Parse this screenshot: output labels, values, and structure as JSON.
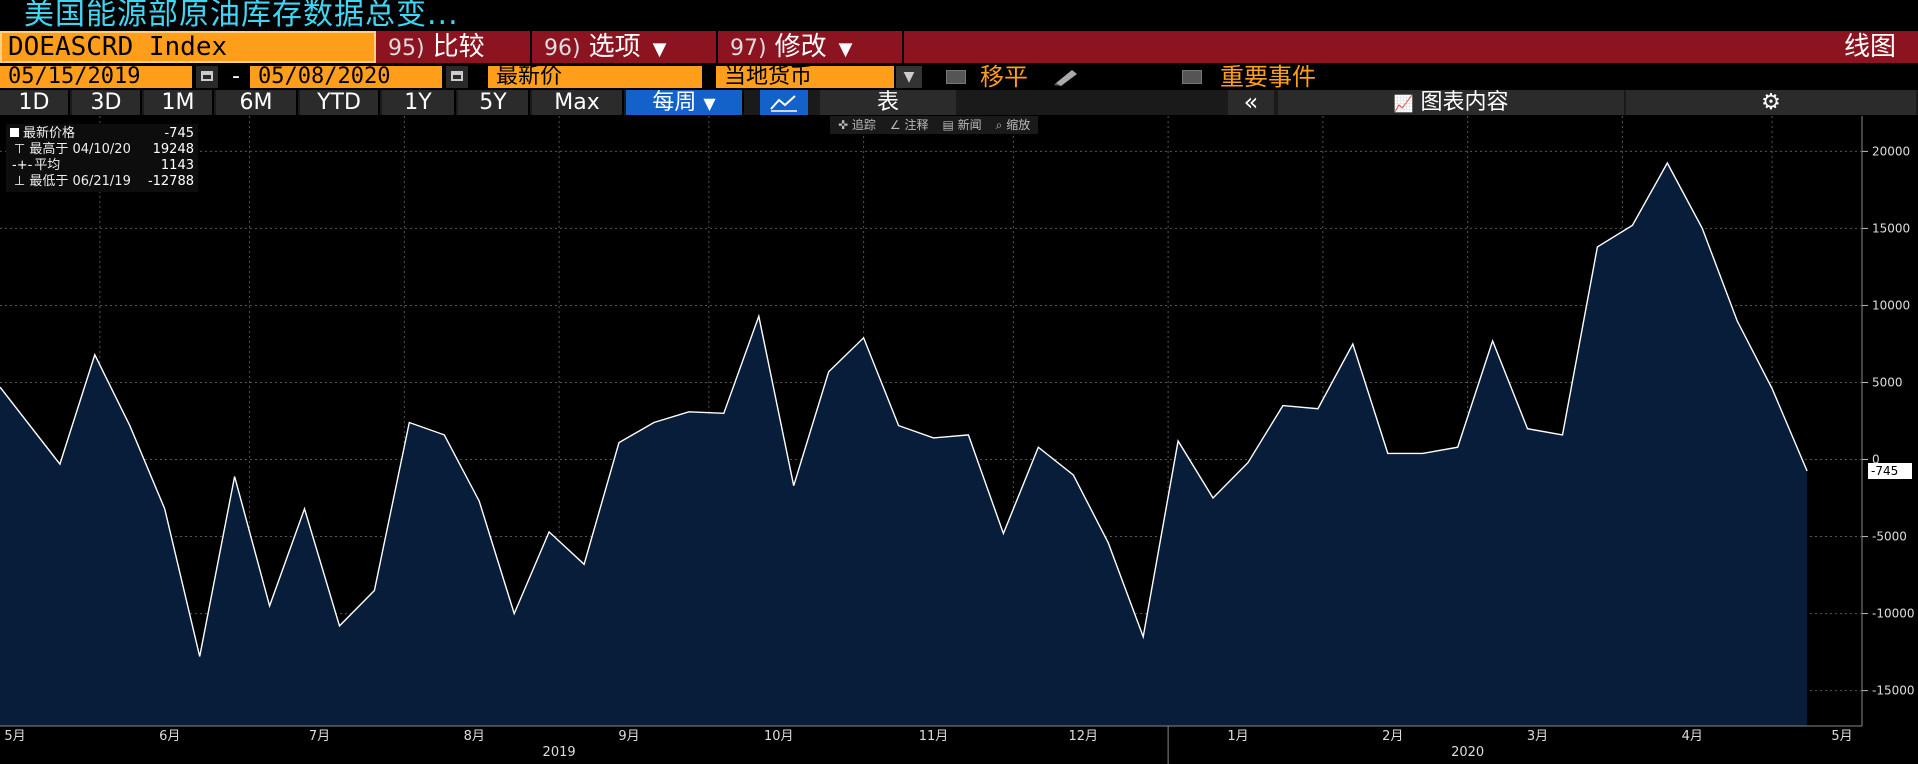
{
  "title": "美国能源部原油库存数据总变...",
  "ticker": "DOEASCRD Index",
  "menus": [
    {
      "num": "95)",
      "label": "比较",
      "arrow": ""
    },
    {
      "num": "96)",
      "label": "选项",
      "arrow": "▼"
    },
    {
      "num": "97)",
      "label": "修改",
      "arrow": "▼"
    }
  ],
  "chart_type_label": "线图",
  "date_start": "05/15/2019",
  "date_sep": "-",
  "date_end": "05/08/2020",
  "price_field": "最新价",
  "currency": "当地货币",
  "moving_avg_label": "移平",
  "events_label": "重要事件",
  "periods": [
    "1D",
    "3D",
    "1M",
    "6M",
    "YTD",
    "1Y",
    "5Y",
    "Max"
  ],
  "frequency": "每周",
  "table_label": "表",
  "chart_content_label": "图表内容",
  "mini_tools": [
    "追踪",
    "注释",
    "新闻",
    "缩放"
  ],
  "legend": [
    {
      "label": "最新价格",
      "value": "-745"
    },
    {
      "label": "最高于 04/10/20",
      "value": "19248"
    },
    {
      "label": "平均",
      "value": "1143"
    },
    {
      "label": "最低于 06/21/19",
      "value": "-12788"
    }
  ],
  "last_value_tag": "-745",
  "colors": {
    "line": "#ffffff",
    "fill": "#071d3a",
    "accent": "#ff9e1b",
    "menu_bar": "#8c1420",
    "title": "#3fd6f5",
    "active": "#1262c9"
  },
  "chart_data": {
    "type": "area",
    "title": "美国能源部原油库存数据总变...",
    "x": [
      "2019-05-17",
      "2019-05-24",
      "2019-05-31",
      "2019-06-07",
      "2019-06-14",
      "2019-06-21",
      "2019-06-28",
      "2019-07-05",
      "2019-07-12",
      "2019-07-19",
      "2019-07-26",
      "2019-08-02",
      "2019-08-09",
      "2019-08-16",
      "2019-08-23",
      "2019-08-30",
      "2019-09-06",
      "2019-09-13",
      "2019-09-20",
      "2019-09-27",
      "2019-10-04",
      "2019-10-11",
      "2019-10-18",
      "2019-10-25",
      "2019-11-01",
      "2019-11-08",
      "2019-11-15",
      "2019-11-22",
      "2019-11-29",
      "2019-12-06",
      "2019-12-13",
      "2019-12-20",
      "2019-12-27",
      "2020-01-03",
      "2020-01-10",
      "2020-01-17",
      "2020-01-24",
      "2020-01-31",
      "2020-02-07",
      "2020-02-14",
      "2020-02-21",
      "2020-02-28",
      "2020-03-06",
      "2020-03-13",
      "2020-03-20",
      "2020-03-27",
      "2020-04-03",
      "2020-04-10",
      "2020-04-17",
      "2020-04-24",
      "2020-05-01",
      "2020-05-08"
    ],
    "values": [
      4700,
      -300,
      6800,
      2200,
      -3200,
      -12788,
      -1100,
      -9500,
      -3200,
      -10800,
      -8500,
      2400,
      1600,
      -2700,
      -10000,
      -4700,
      -6800,
      1100,
      2400,
      3100,
      3000,
      9300,
      -1700,
      5700,
      7900,
      2200,
      1400,
      1600,
      -4800,
      800,
      -1000,
      -5400,
      -11500,
      1200,
      -2500,
      -200,
      3500,
      3300,
      7500,
      400,
      400,
      800,
      7700,
      2000,
      1600,
      13800,
      15200,
      19248,
      15000,
      9000,
      4600,
      -745
    ],
    "ylim": [
      -16000,
      21000
    ],
    "yticks": [
      -15000,
      -10000,
      -5000,
      0,
      5000,
      10000,
      15000,
      20000
    ],
    "xticks": [
      {
        "label": "5月",
        "date": "2019-05-15"
      },
      {
        "label": "6月",
        "date": "2019-06-15"
      },
      {
        "label": "7月",
        "date": "2019-07-15"
      },
      {
        "label": "8月",
        "date": "2019-08-15"
      },
      {
        "label": "9月",
        "date": "2019-09-15"
      },
      {
        "label": "10月",
        "date": "2019-10-15"
      },
      {
        "label": "11月",
        "date": "2019-11-15"
      },
      {
        "label": "12月",
        "date": "2019-12-15"
      },
      {
        "label": "1月",
        "date": "2020-01-15"
      },
      {
        "label": "2月",
        "date": "2020-02-15"
      },
      {
        "label": "3月",
        "date": "2020-03-15"
      },
      {
        "label": "4月",
        "date": "2020-04-15"
      },
      {
        "label": "5月",
        "date": "2020-05-15"
      }
    ],
    "years": [
      {
        "label": "2019",
        "date": "2019-09-01"
      },
      {
        "label": "2020",
        "date": "2020-03-01"
      }
    ],
    "grid": true,
    "legend_position": "top-left"
  }
}
